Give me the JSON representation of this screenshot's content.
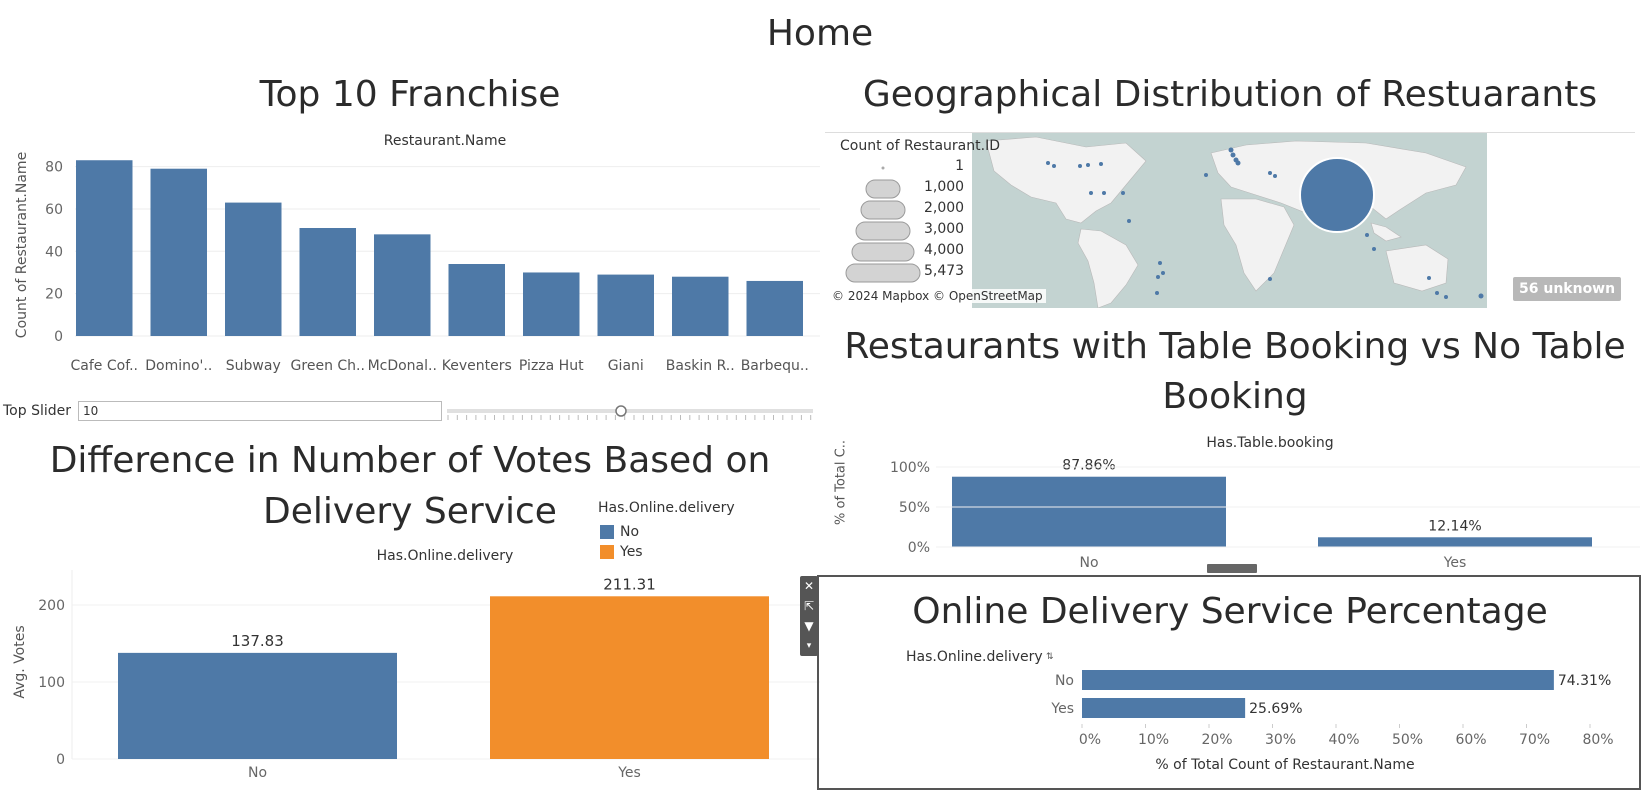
{
  "dashboard_title": "Home",
  "top10": {
    "title": "Top 10 Franchise",
    "header": "Restaurant.Name",
    "ylabel": "Count of Restaurant.Name",
    "slider_label": "Top Slider",
    "slider_value": "10"
  },
  "geo": {
    "title": "Geographical Distribution of Restuarants",
    "legend_title": "Count of Restaurant.ID",
    "legend_items": [
      "1",
      "1,000",
      "2,000",
      "3,000",
      "4,000",
      "5,473"
    ],
    "attribution": "© 2024 Mapbox © OpenStreetMap",
    "unknown": "56 unknown"
  },
  "booking": {
    "title": "Restaurants with Table Booking vs No Table Booking",
    "header": "Has.Table.booking",
    "ylabel": "% of Total C..",
    "percent_labels": [
      "87.86%",
      "12.14%"
    ],
    "y_ticks": [
      "100%",
      "50%",
      "0%"
    ],
    "categories": [
      "No",
      "Yes"
    ]
  },
  "votes": {
    "title": "Difference in Number of Votes Based on Delivery Service",
    "header": "Has.Online.delivery",
    "ylabel": "Avg. Votes",
    "legend_title": "Has.Online.delivery",
    "legend_items": [
      "No",
      "Yes"
    ],
    "value_labels": [
      "137.83",
      "211.31"
    ],
    "y_ticks": [
      "200",
      "100",
      "0"
    ],
    "categories": [
      "No",
      "Yes"
    ]
  },
  "online": {
    "title": "Online Delivery Service Percentage",
    "header": "Has.Online.delivery",
    "xlabel": "% of Total Count of Restaurant.Name",
    "value_labels": [
      "74.31%",
      "25.69%"
    ],
    "x_ticks": [
      "0%",
      "10%",
      "20%",
      "30%",
      "40%",
      "50%",
      "60%",
      "70%",
      "80%"
    ],
    "categories": [
      "No",
      "Yes"
    ]
  },
  "colors": {
    "blue": "#4e79a7",
    "orange": "#f28e2b",
    "map": "#c3d3d1"
  },
  "chart_data": [
    {
      "type": "bar",
      "categories": [
        "Cafe Cof..",
        "Domino'..",
        "Subway",
        "Green Ch..",
        "McDonal..",
        "Keventers",
        "Pizza Hut",
        "Giani",
        "Baskin R..",
        "Barbequ.."
      ],
      "values": [
        83,
        79,
        63,
        51,
        48,
        34,
        30,
        29,
        28,
        26
      ],
      "title": "Top 10 Franchise",
      "xlabel": "Restaurant.Name",
      "ylabel": "Count of Restaurant.Name",
      "yticks": [
        0,
        20,
        40,
        60,
        80
      ],
      "ylim": [
        0,
        85
      ],
      "grid": true
    },
    {
      "type": "bar",
      "categories": [
        "No",
        "Yes"
      ],
      "values": [
        87.86,
        12.14
      ],
      "title": "Restaurants with Table Booking vs No Table Booking",
      "xlabel": "Has.Table.booking",
      "ylabel": "% of Total C..",
      "yticks": [
        0,
        50,
        100
      ],
      "ylim": [
        0,
        100
      ]
    },
    {
      "type": "bar",
      "categories": [
        "No",
        "Yes"
      ],
      "values": [
        137.83,
        211.31
      ],
      "title": "Difference in Number of Votes Based on Delivery Service",
      "xlabel": "Has.Online.delivery",
      "ylabel": "Avg. Votes",
      "yticks": [
        0,
        100,
        200
      ],
      "ylim": [
        0,
        220
      ],
      "legend": "top-right"
    },
    {
      "type": "bar",
      "orientation": "horizontal",
      "categories": [
        "No",
        "Yes"
      ],
      "values": [
        74.31,
        25.69
      ],
      "title": "Online Delivery Service Percentage",
      "xlabel": "% of Total Count of Restaurant.Name",
      "ylabel": "Has.Online.delivery",
      "xticks": [
        0,
        10,
        20,
        30,
        40,
        50,
        60,
        70,
        80
      ],
      "xlim": [
        0,
        80
      ]
    }
  ]
}
